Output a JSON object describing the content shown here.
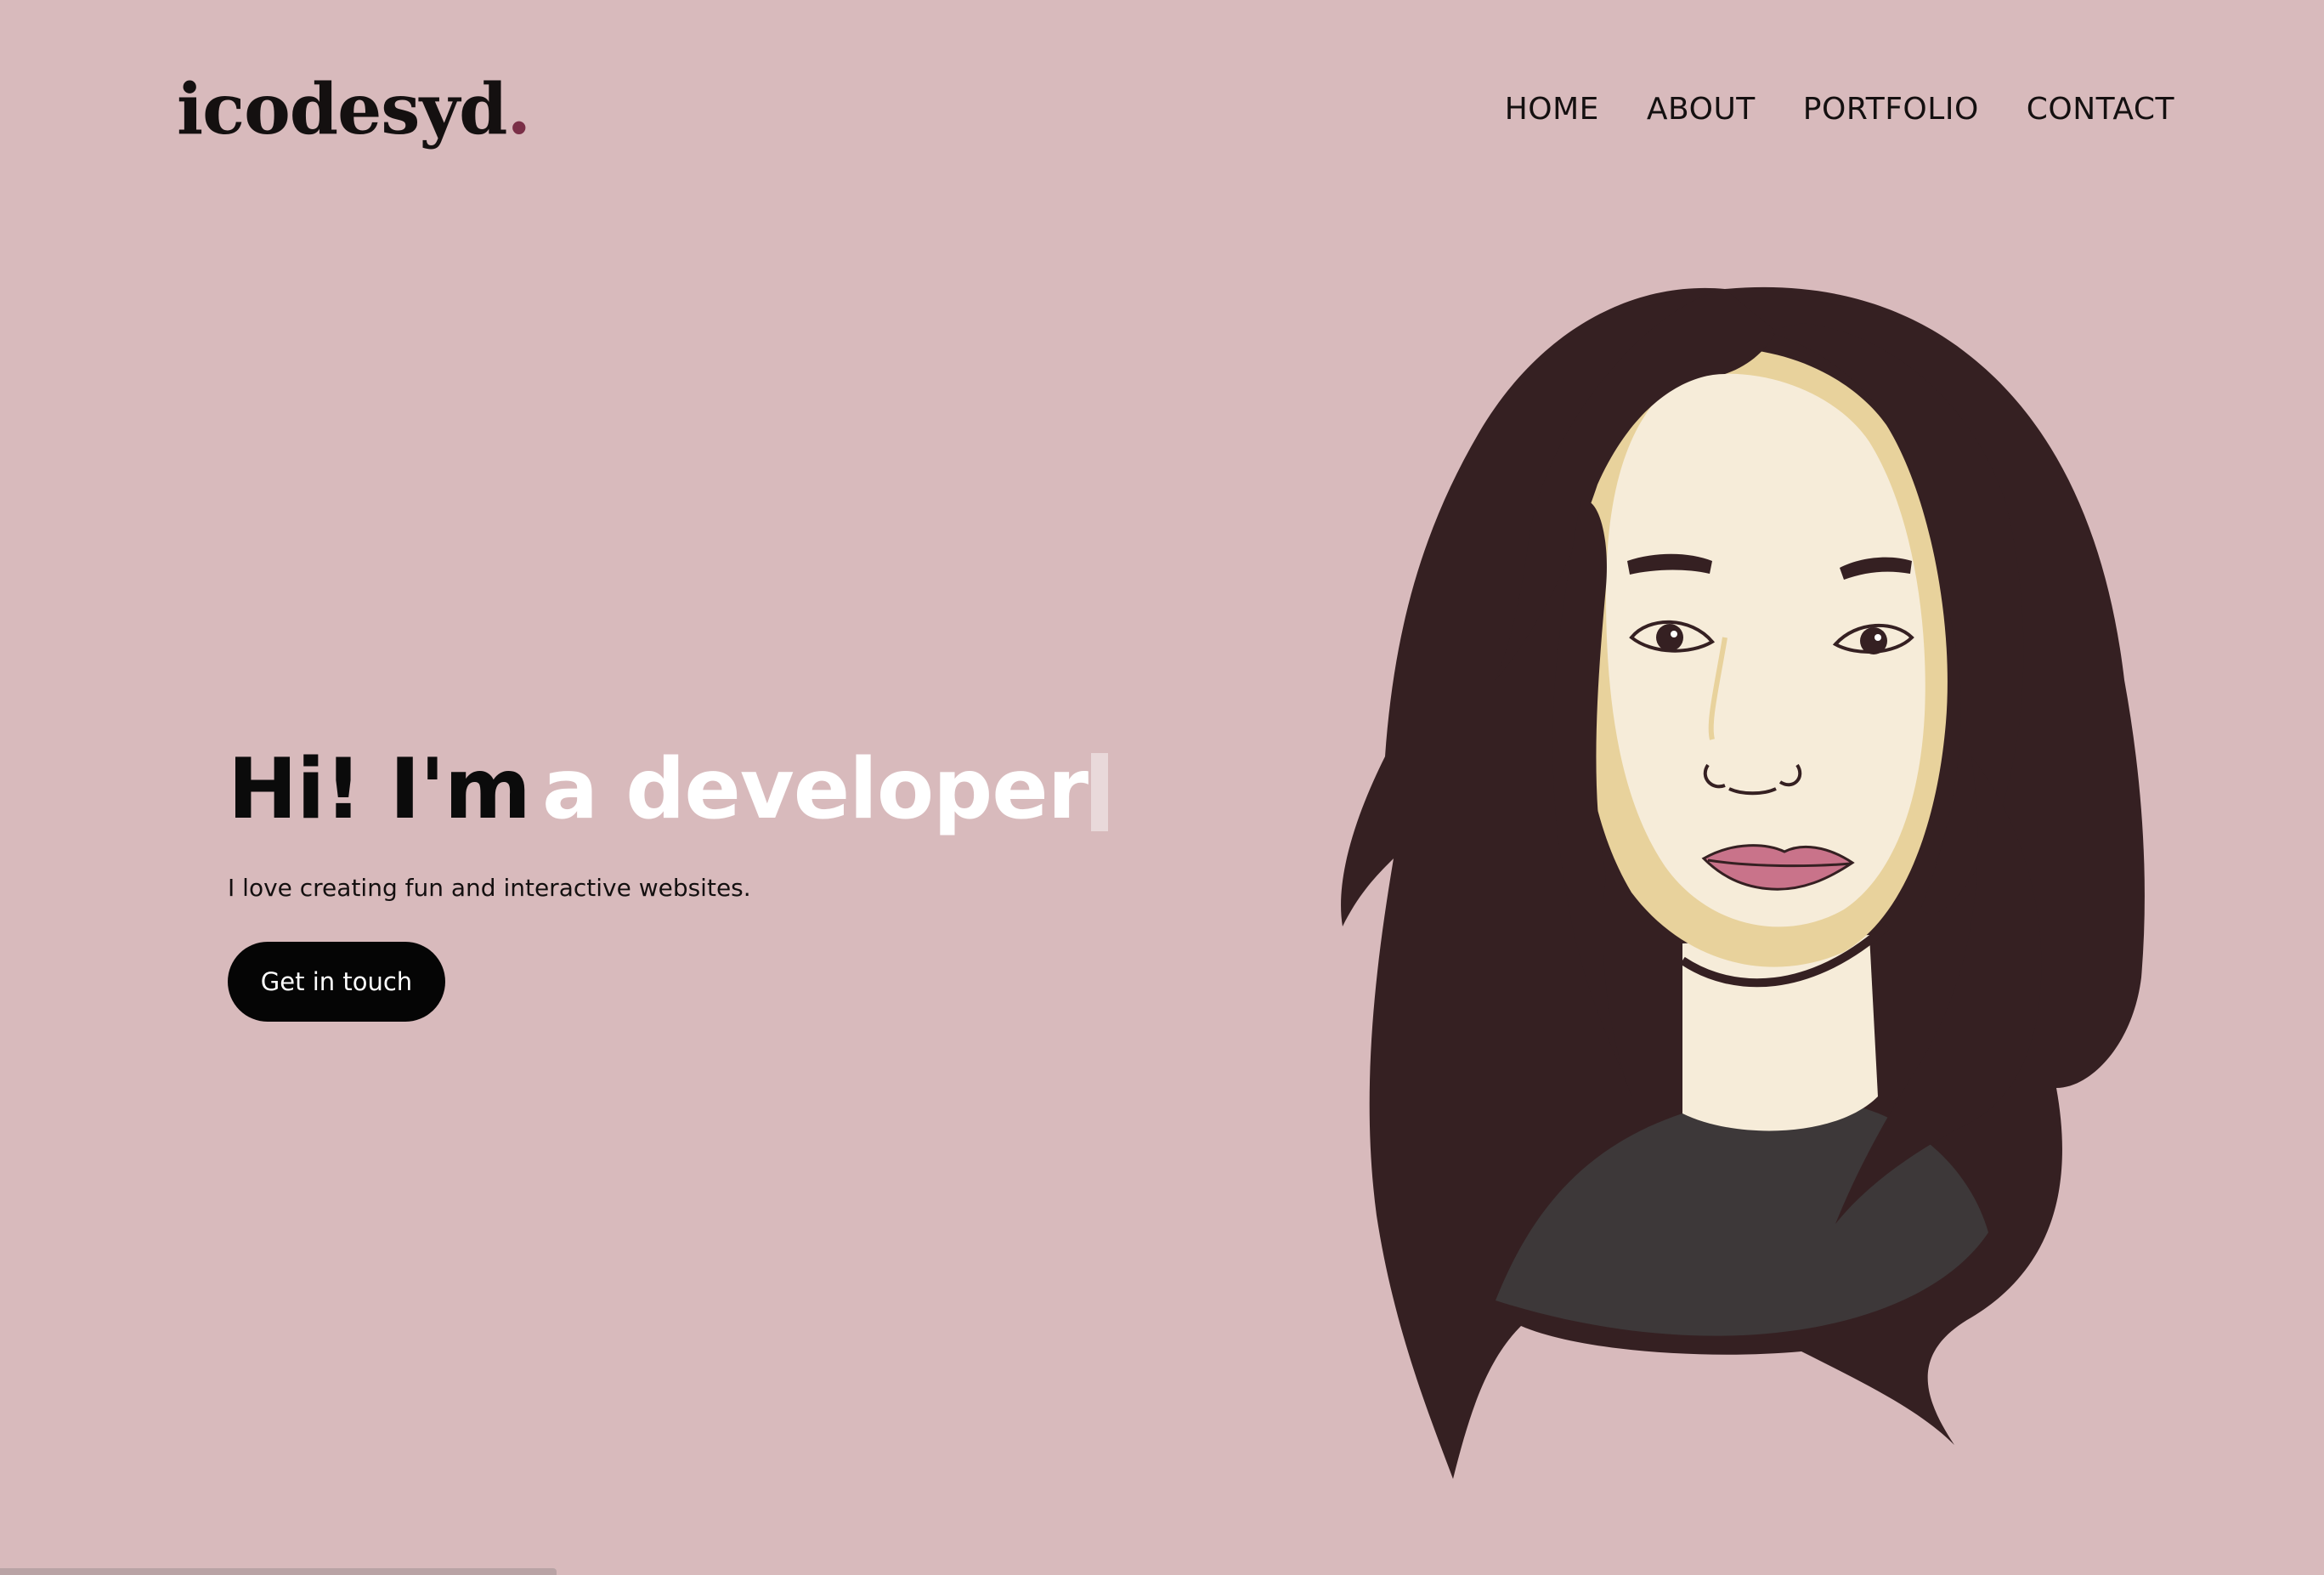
{
  "brand": {
    "name": "icodesyd",
    "dot": ".",
    "accent_color": "#7a2f47"
  },
  "nav": {
    "items": [
      {
        "label": "HOME"
      },
      {
        "label": "ABOUT"
      },
      {
        "label": "PORTFOLIO"
      },
      {
        "label": "CONTACT"
      }
    ]
  },
  "hero": {
    "title_static": "Hi! I'm",
    "title_typed": "a developer",
    "tagline": "I love creating fun and interactive websites.",
    "cta_label": "Get in touch"
  },
  "colors": {
    "background": "#d8babc",
    "text": "#141010",
    "button": "#050505",
    "hair": "#352022",
    "skin": "#f6ecd9",
    "shadow": "#e8d29c",
    "lips": "#c9738a",
    "shirt": "#3d3839"
  },
  "illustration": {
    "icon": "portrait-illustration"
  }
}
